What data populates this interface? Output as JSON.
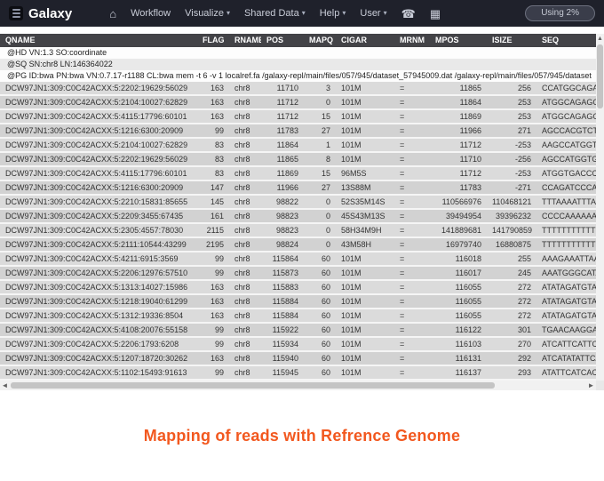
{
  "navbar": {
    "brand": "Galaxy",
    "usage": "Using 2%",
    "items": [
      {
        "icon": "home",
        "label": ""
      },
      {
        "label": "Workflow"
      },
      {
        "label": "Visualize",
        "caret": true
      },
      {
        "label": "Shared Data",
        "caret": true
      },
      {
        "label": "Help",
        "caret": true
      },
      {
        "label": "User",
        "caret": true
      },
      {
        "icon": "phone",
        "label": ""
      },
      {
        "icon": "grid",
        "label": ""
      }
    ]
  },
  "table": {
    "columns": [
      "QNAME",
      "FLAG",
      "RNAME",
      "POS",
      "MAPQ",
      "CIGAR",
      "MRNM",
      "MPOS",
      "ISIZE",
      "SEQ"
    ],
    "header_lines": [
      "@HD VN:1.3 SO:coordinate",
      "@SQ SN:chr8 LN:146364022",
      "@PG ID:bwa PN:bwa VN:0.7.17-r1188 CL:bwa mem -t 6 -v 1 localref.fa /galaxy-repl/main/files/057/945/dataset_57945009.dat /galaxy-repl/main/files/057/945/dataset"
    ],
    "rows": [
      [
        "DCW97JN1:309:C0C42ACXX:5:2202:19629:56029",
        "163",
        "chr8",
        "11710",
        "3",
        "101M",
        "=",
        "11865",
        "256",
        "CCATGGCAGAG"
      ],
      [
        "DCW97JN1:309:C0C42ACXX:5:2104:10027:62829",
        "163",
        "chr8",
        "11712",
        "0",
        "101M",
        "=",
        "11864",
        "253",
        "ATGGCAGAGCT"
      ],
      [
        "DCW97JN1:309:C0C42ACXX:5:4115:17796:60101",
        "163",
        "chr8",
        "11712",
        "15",
        "101M",
        "=",
        "11869",
        "253",
        "ATGGCAGAGCT"
      ],
      [
        "DCW97JN1:309:C0C42ACXX:5:1216:6300:20909",
        "99",
        "chr8",
        "11783",
        "27",
        "101M",
        "=",
        "11966",
        "271",
        "AGCCACGTCTC"
      ],
      [
        "DCW97JN1:309:C0C42ACXX:5:2104:10027:62829",
        "83",
        "chr8",
        "11864",
        "1",
        "101M",
        "=",
        "11712",
        "-253",
        "AAGCCATGGTG"
      ],
      [
        "DCW97JN1:309:C0C42ACXX:5:2202:19629:56029",
        "83",
        "chr8",
        "11865",
        "8",
        "101M",
        "=",
        "11710",
        "-256",
        "AGCCATGGTGA"
      ],
      [
        "DCW97JN1:309:C0C42ACXX:5:4115:17796:60101",
        "83",
        "chr8",
        "11869",
        "15",
        "96M5S",
        "=",
        "11712",
        "-253",
        "ATGGTGACCCA"
      ],
      [
        "DCW97JN1:309:C0C42ACXX:5:1216:6300:20909",
        "147",
        "chr8",
        "11966",
        "27",
        "13S88M",
        "=",
        "11783",
        "-271",
        "CCAGATCCCAA"
      ],
      [
        "DCW97JN1:309:C0C42ACXX:5:2210:15831:85655",
        "145",
        "chr8",
        "98822",
        "0",
        "52S35M14S",
        "=",
        "110566976",
        "110468121",
        "TTTAAAATTTA"
      ],
      [
        "DCW97JN1:309:C0C42ACXX:5:2209:3455:67435",
        "161",
        "chr8",
        "98823",
        "0",
        "45S43M13S",
        "=",
        "39494954",
        "39396232",
        "CCCCAAAAAAA"
      ],
      [
        "DCW97JN1:309:C0C42ACXX:5:2305:4557:78030",
        "2115",
        "chr8",
        "98823",
        "0",
        "58H34M9H",
        "=",
        "141889681",
        "141790859",
        "TTTTTTTTTTT"
      ],
      [
        "DCW97JN1:309:C0C42ACXX:5:2111:10544:43299",
        "2195",
        "chr8",
        "98824",
        "0",
        "43M58H",
        "=",
        "16979740",
        "16880875",
        "TTTTTTTTTTT"
      ],
      [
        "DCW97JN1:309:C0C42ACXX:5:4211:6915:3569",
        "99",
        "chr8",
        "115864",
        "60",
        "101M",
        "=",
        "116018",
        "255",
        "AAAGAAATTAA"
      ],
      [
        "DCW97JN1:309:C0C42ACXX:5:2206:12976:57510",
        "99",
        "chr8",
        "115873",
        "60",
        "101M",
        "=",
        "116017",
        "245",
        "AAATGGGCATA"
      ],
      [
        "DCW97JN1:309:C0C42ACXX:5:1313:14027:15986",
        "163",
        "chr8",
        "115883",
        "60",
        "101M",
        "=",
        "116055",
        "272",
        "ATATAGATGTAC"
      ],
      [
        "DCW97JN1:309:C0C42ACXX:5:1218:19040:61299",
        "163",
        "chr8",
        "115884",
        "60",
        "101M",
        "=",
        "116055",
        "272",
        "ATATAGATGTAC"
      ],
      [
        "DCW97JN1:309:C0C42ACXX:5:1312:19336:8504",
        "163",
        "chr8",
        "115884",
        "60",
        "101M",
        "=",
        "116055",
        "272",
        "ATATAGATGTAC"
      ],
      [
        "DCW97JN1:309:C0C42ACXX:5:4108:20076:55158",
        "99",
        "chr8",
        "115922",
        "60",
        "101M",
        "=",
        "116122",
        "301",
        "TGAACAAGGAA"
      ],
      [
        "DCW97JN1:309:C0C42ACXX:5:2206:1793:6208",
        "99",
        "chr8",
        "115934",
        "60",
        "101M",
        "=",
        "116103",
        "270",
        "ATCATTCATTC"
      ],
      [
        "DCW97JN1:309:C0C42ACXX:5:1207:18720:30262",
        "163",
        "chr8",
        "115940",
        "60",
        "101M",
        "=",
        "116131",
        "292",
        "ATCATATATTCA"
      ],
      [
        "DCW97JN1:309:C0C42ACXX:5:1102:15493:91613",
        "99",
        "chr8",
        "115945",
        "60",
        "101M",
        "=",
        "116137",
        "293",
        "ATATTCATCAC"
      ]
    ]
  },
  "scrollbars": {
    "h_left_arrow": "◄",
    "h_right_arrow": "►",
    "v_up_arrow": "▲",
    "v_down_arrow": "▼"
  },
  "caption": "Mapping of reads with Refrence Genome",
  "colors": {
    "accent": "#f2581f",
    "masthead": "#1f212b",
    "table_header": "#434347"
  }
}
